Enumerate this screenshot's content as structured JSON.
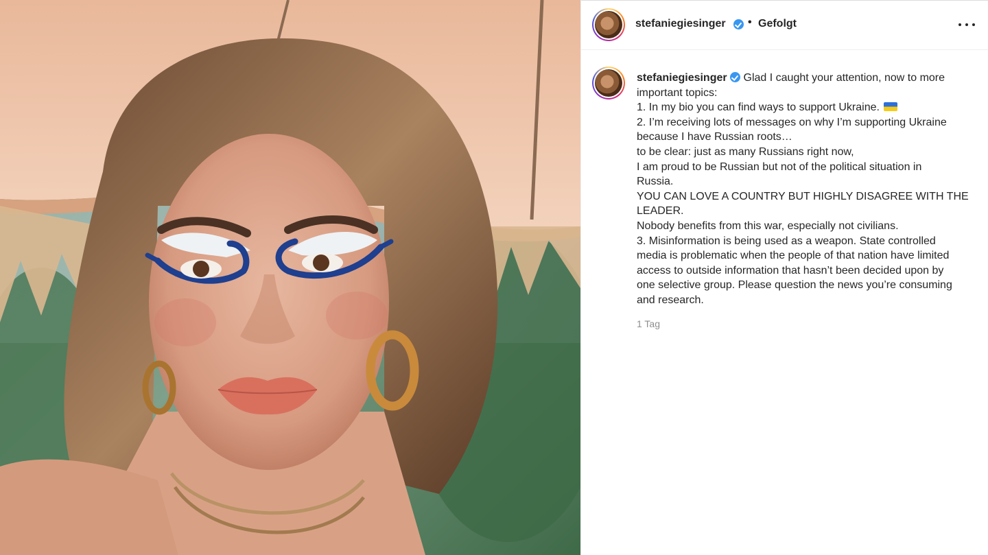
{
  "post": {
    "header": {
      "username": "stefaniegiesinger",
      "separator": "•",
      "follow_status": "Gefolgt"
    },
    "caption": {
      "username": "stefaniegiesinger",
      "lines": [
        "Glad I caught your attention, now to more",
        "important topics:",
        "1. In my bio you can find ways to support Ukraine.",
        "2. I’m receiving lots of messages on why I’m supporting Ukraine",
        "because I have Russian roots…",
        "to be clear: just as many Russians right now,",
        "I am proud to be Russian but not of the political situation in",
        "Russia.",
        "YOU CAN LOVE A COUNTRY BUT HIGHLY DISAGREE WITH THE",
        "LEADER.",
        "Nobody benefits from this war, especially not civilians.",
        "3. Misinformation is being used as a weapon. State controlled",
        "media is problematic when the people of that nation have limited",
        "access to outside information that hasn’t been decided upon by",
        "one selective group. Please question the news you’re consuming",
        "and research."
      ]
    },
    "timestamp": "1 Tag"
  },
  "icons": {
    "verified": "verified-badge-icon",
    "more": "more-options-icon",
    "flag": "ukraine-flag-emoji"
  },
  "colors": {
    "text": "#262626",
    "secondary": "#8e8e8e",
    "verified": "#3897f0",
    "border": "#efefef"
  }
}
